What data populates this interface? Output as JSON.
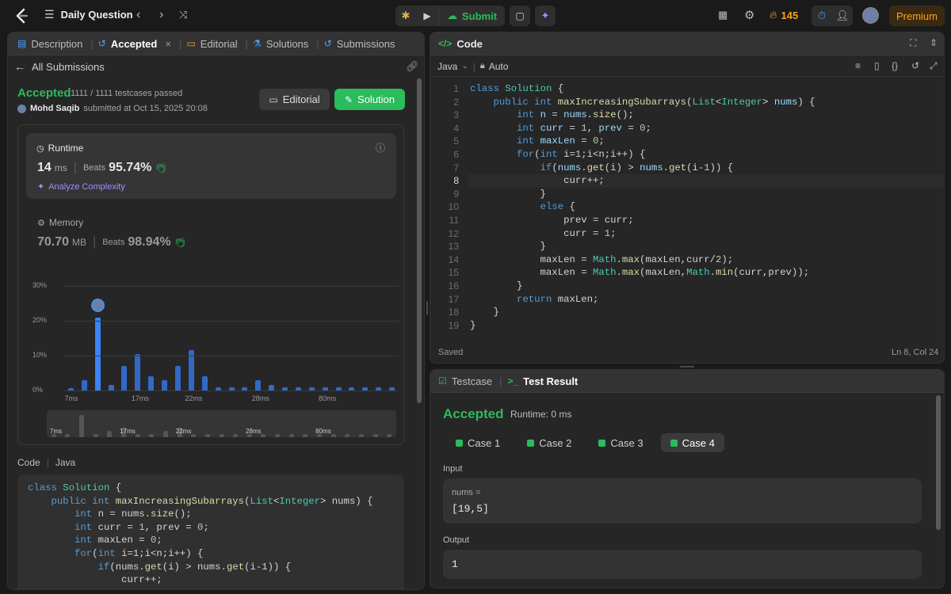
{
  "nav": {
    "title": "Daily Question",
    "submit_label": "Submit",
    "streak": "145",
    "premium_label": "Premium"
  },
  "left": {
    "tabs": {
      "description": "Description",
      "accepted": "Accepted",
      "editorial": "Editorial",
      "solutions": "Solutions",
      "submissions": "Submissions"
    },
    "all_submissions": "All Submissions",
    "status": "Accepted",
    "testcases": "1111 / 1111 testcases passed",
    "user": "Mohd Saqib",
    "submitted_at": "submitted at Oct 15, 2025 20:08",
    "editorial_btn": "Editorial",
    "solution_btn": "Solution",
    "runtime": {
      "label": "Runtime",
      "value": "14",
      "unit": "ms",
      "beats_label": "Beats",
      "beats": "95.74%",
      "analyze": "Analyze Complexity"
    },
    "memory": {
      "label": "Memory",
      "value": "70.70",
      "unit": "MB",
      "beats_label": "Beats",
      "beats": "98.94%"
    },
    "code_label": "Code",
    "code_lang": "Java"
  },
  "chart_data": {
    "type": "bar",
    "yticks": [
      "30%",
      "20%",
      "10%",
      "0%"
    ],
    "ylim": [
      0,
      30
    ],
    "xticks": [
      "7ms",
      "17ms",
      "22ms",
      "28ms",
      "80ms"
    ],
    "values": [
      0.5,
      3,
      21,
      1.5,
      7,
      10.5,
      4,
      3,
      7,
      11.5,
      4,
      1,
      1,
      1,
      3,
      1.5,
      1,
      1,
      1,
      1,
      1,
      1,
      1,
      1,
      1
    ],
    "highlight_index": 2,
    "mini_xticks": [
      "7ms",
      "17ms",
      "22ms",
      "28ms",
      "80ms"
    ],
    "mini_values": [
      1,
      1,
      7,
      1,
      2,
      3,
      1,
      1,
      2,
      3,
      1,
      1,
      1,
      1,
      1,
      1,
      1,
      1,
      1,
      1,
      1,
      1,
      1,
      1,
      1
    ]
  },
  "right": {
    "code_title": "Code",
    "language": "Java",
    "auto": "Auto",
    "saved": "Saved",
    "cursor": "Ln 8, Col 24",
    "testcase_tab": "Testcase",
    "result_tab": "Test Result",
    "result_status": "Accepted",
    "result_runtime": "Runtime: 0 ms",
    "cases": [
      "Case 1",
      "Case 2",
      "Case 3",
      "Case 4"
    ],
    "input_label": "Input",
    "param_name": "nums =",
    "param_value": "[19,5]",
    "output_label": "Output",
    "output_value": "1"
  }
}
